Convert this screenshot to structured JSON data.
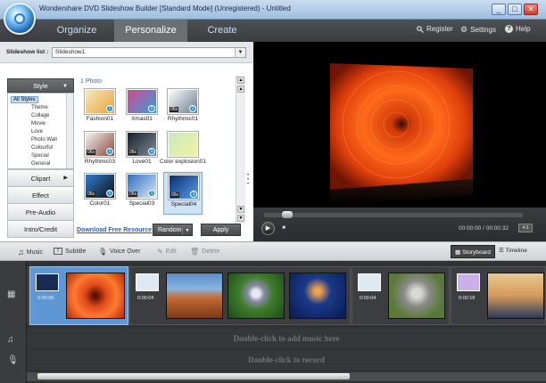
{
  "window": {
    "title": "Wondershare DVD Slideshow Builder [Standard Mode] (Unregistered) - Untitled",
    "minimize": "_",
    "maximize": "□",
    "close": "✕"
  },
  "nav": {
    "tabs": [
      "Organize",
      "Personalize",
      "Create"
    ],
    "active": "Personalize",
    "links": {
      "register": "Register",
      "settings": "Settings",
      "help": "Help"
    }
  },
  "slideshow_list": {
    "label": "Slideshow list :",
    "value": "Slideshow1"
  },
  "sidebar": {
    "style_header": "Style",
    "tree": [
      "All Styles",
      "Theme",
      "Collage",
      "Movie",
      "Love",
      "Photo Wall",
      "Colourful",
      "Special",
      "General"
    ],
    "buttons": [
      "Clipart",
      "Effect",
      "Pre-Audio",
      "Intro/Credit"
    ]
  },
  "grid": {
    "count_label": "1 Photo",
    "items": [
      {
        "caption": "Fashion01",
        "colors": [
          "#f6e9c0",
          "#e8a238"
        ],
        "badge": "",
        "num": "1"
      },
      {
        "caption": "Xmas01",
        "colors": [
          "#d24a8a",
          "#3a9be0"
        ],
        "badge": "",
        "num": "1"
      },
      {
        "caption": "Rhythmic01",
        "colors": [
          "#ffffff",
          "#6a7d8e"
        ],
        "badge": "06s",
        "num": "1"
      },
      {
        "caption": "Rhythmic03",
        "colors": [
          "#f4f4f4",
          "#8a4a3a"
        ],
        "badge": "06s",
        "num": "1"
      },
      {
        "caption": "Love01",
        "colors": [
          "#1a1d22",
          "#7b8fa0"
        ],
        "badge": "06s",
        "num": "1"
      },
      {
        "caption": "Color explosion01",
        "colors": [
          "#c9e8c2",
          "#f2f2a0"
        ],
        "badge": "",
        "num": ""
      },
      {
        "caption": "Color01",
        "colors": [
          "#2f7ccf",
          "#111111"
        ],
        "badge": "06s",
        "num": "1"
      },
      {
        "caption": "Special03",
        "colors": [
          "#2e6fc0",
          "#d9e9f6"
        ],
        "badge": "06s",
        "num": "1"
      },
      {
        "caption": "Special04",
        "colors": [
          "#0d2d6a",
          "#55a0f0"
        ],
        "badge": "06s",
        "num": "1"
      }
    ],
    "download_link": "Download Free Resource",
    "random_label": "Random",
    "apply_label": "Apply"
  },
  "player": {
    "time": "00:00:00 / 00:00:32",
    "fullscreen": "4:3"
  },
  "toolbar": {
    "music": "Music",
    "subtitle": "Subtitle",
    "voice_over": "Voice Over",
    "edit": "Edit",
    "delete": "Delete",
    "storyboard": "Storyboard",
    "timeline": "Timeline"
  },
  "storyboard": {
    "clips": [
      {
        "duration": "0:00:06",
        "selected": true,
        "images": [
          "#e04a1a"
        ]
      },
      {
        "duration": "0:00:04",
        "selected": false,
        "images": [
          "#c46a34",
          "#3f7d2e",
          "#1a3a8a"
        ]
      },
      {
        "duration": "0:00:04",
        "selected": false,
        "images": [
          "#8a8a86"
        ]
      },
      {
        "duration": "0:00:18",
        "selected": false,
        "images": [
          "#d49a5a"
        ]
      }
    ],
    "music_hint": "Double-click to add music here",
    "record_hint": "Double-click to record"
  },
  "colors": {
    "accent": "#5f97d5",
    "nav_active": "#6c6e72",
    "link": "#2a5fb0"
  }
}
